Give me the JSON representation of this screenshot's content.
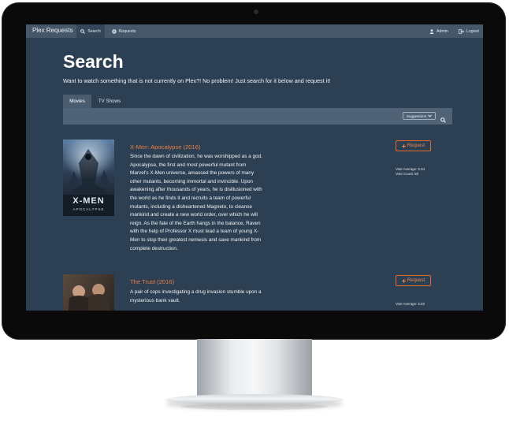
{
  "app": {
    "brand": "Plex Requests"
  },
  "nav": {
    "search": "Search",
    "requests": "Requests",
    "admin": "Admin",
    "logout": "Logout"
  },
  "page": {
    "title": "Search",
    "subtitle": "Want to watch something that is not currently on Plex?! No problem! Just search for it below and request it!"
  },
  "tabs": [
    {
      "label": "Movies",
      "active": true
    },
    {
      "label": "TV Shows",
      "active": false
    }
  ],
  "search": {
    "suggestions_label": "Suggestions"
  },
  "results": [
    {
      "title": "X-Men: Apocalypse (2016)",
      "overview_lines": [
        "Since the dawn of civilization, he was worshipped as a god.",
        "Apocalypse, the first and most powerful mutant from",
        "Marvel's X-Men universe, amassed the powers of many",
        "other mutants, becoming immortal and invincible. Upon",
        "awakening after thousands of years, he is disillusioned with",
        "the world as he finds it and recruits a team of powerful",
        "mutants, including a disheartened Magneto, to cleanse",
        "mankind and create a new world order, over which he will",
        "reign. As the fate of the Earth hangs in the balance, Raven",
        "with the help of Professor X must lead a team of young X-",
        "Men to stop their greatest nemesis and save mankind from",
        "complete destruction."
      ],
      "request_label": "Request",
      "vote_average": "Vote Average: 5.04",
      "vote_count": "Vote Count: 50",
      "poster_text": "X-MEN",
      "poster_subtext": "APOCALYPSE"
    },
    {
      "title": "The Trust (2016)",
      "overview_lines": [
        "A pair of cops investigating a drug invasion stumble upon a",
        "mysterious bank vault."
      ],
      "request_label": "Request",
      "vote_average": "Vote Average: 5.92",
      "vote_count": ""
    }
  ],
  "colors": {
    "screen_bg": "#2d3f52",
    "navbar_bg": "#46576a",
    "accent": "#e8804a",
    "search_bar_bg": "#4f6276"
  },
  "icons": [
    "search-icon",
    "requests-icon",
    "user-icon",
    "logout-icon",
    "plus-icon",
    "chevron-down-icon"
  ]
}
